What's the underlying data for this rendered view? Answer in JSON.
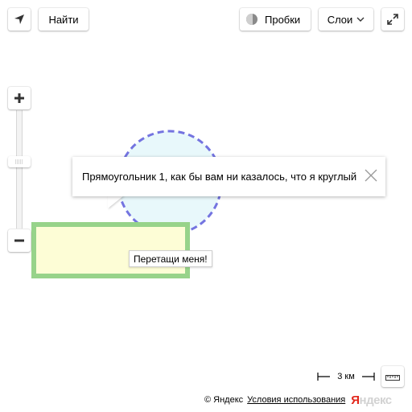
{
  "controls": {
    "find_label": "Найти",
    "traffic_label": "Пробки",
    "layers_label": "Слои"
  },
  "balloon": {
    "text": "Прямоугольник 1, как бы вам ни казалось, что я круглый"
  },
  "hint": {
    "text": "Перетащи меня!"
  },
  "scale": {
    "label": "3 км"
  },
  "footer": {
    "copyright": "© Яндекс",
    "terms_link": "Условия использования",
    "logo_first_letter": "Я",
    "logo_rest": "ндекс"
  },
  "colors": {
    "rectangle_fill": "#fdfdd6",
    "rectangle_stroke": "#97d38a",
    "circle_fill": "#e8f8fb",
    "circle_stroke": "#7474e0",
    "logo_red": "#e2271c"
  },
  "icons": {
    "geolocation": "navigation-arrow-icon",
    "traffic": "traffic-light-icon",
    "layers": "chevron-down-icon",
    "fullscreen": "expand-arrows-icon",
    "zoom_in": "plus-icon",
    "zoom_out": "minus-icon",
    "close": "close-icon",
    "ruler": "ruler-icon"
  }
}
